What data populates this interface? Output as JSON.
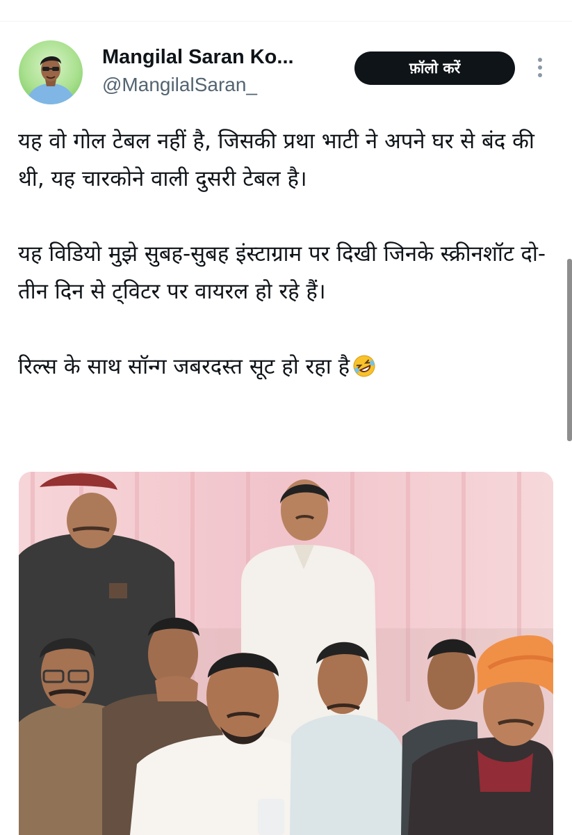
{
  "tweet": {
    "author": {
      "display_name": "Mangilal Saran Ko...",
      "handle": "@MangilalSaran_"
    },
    "follow_label": "फ़ॉलो करें",
    "more_icon": "more-vertical-icon",
    "paragraphs": [
      "यह वो गोल टेबल नहीं है, जिसकी प्रथा भाटी ने अपने घर से बंद की थी, यह चारकोने वाली दुसरी टेबल है।",
      "यह विडियो मुझे सुबह-सुबह इंस्टाग्राम पर दिखी जिनके स्क्रीनशॉट दो-तीन दिन से ट्विटर पर वायरल हो रहे हैं।",
      "रिल्स के साथ सॉन्ग जबरदस्त सूट हो रहा है"
    ],
    "emoji": "rolling-on-floor-laughing-emoji"
  },
  "colors": {
    "text": "#0f1419",
    "secondary_text": "#536471",
    "follow_bg": "#0f1419",
    "follow_text": "#ffffff",
    "curtain_pink": "#f3c9cf",
    "turban_orange": "#f08a3c"
  }
}
